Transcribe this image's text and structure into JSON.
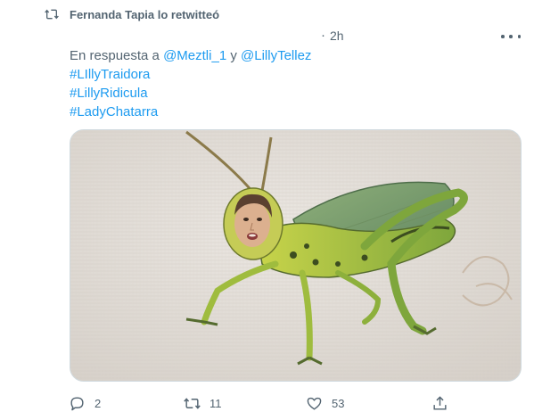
{
  "retweet": {
    "text": "Fernanda Tapia lo retwitteó",
    "icon": "retweet-icon"
  },
  "tweet": {
    "separator": "·",
    "time": "2h",
    "more_icon": "more-options-icon",
    "reply_prefix": "En respuesta a ",
    "mention_1": "@Meztli_1",
    "reply_conjunction": " y ",
    "mention_2": "@LillyTellez",
    "hashtags": [
      "#LIllyTraidora",
      "#LillyRidicula",
      "#LadyChatarra"
    ],
    "media": "grasshopper-with-face-image"
  },
  "actions": {
    "reply": {
      "icon": "reply-icon",
      "count": "2"
    },
    "retweet": {
      "icon": "retweet-icon",
      "count": "11"
    },
    "like": {
      "icon": "heart-icon",
      "count": "53"
    },
    "share": {
      "icon": "share-icon"
    }
  },
  "colors": {
    "accent": "#1d9bf0",
    "secondary_text": "#536471",
    "primary_text": "#0f1419",
    "border": "#cfd9de"
  }
}
